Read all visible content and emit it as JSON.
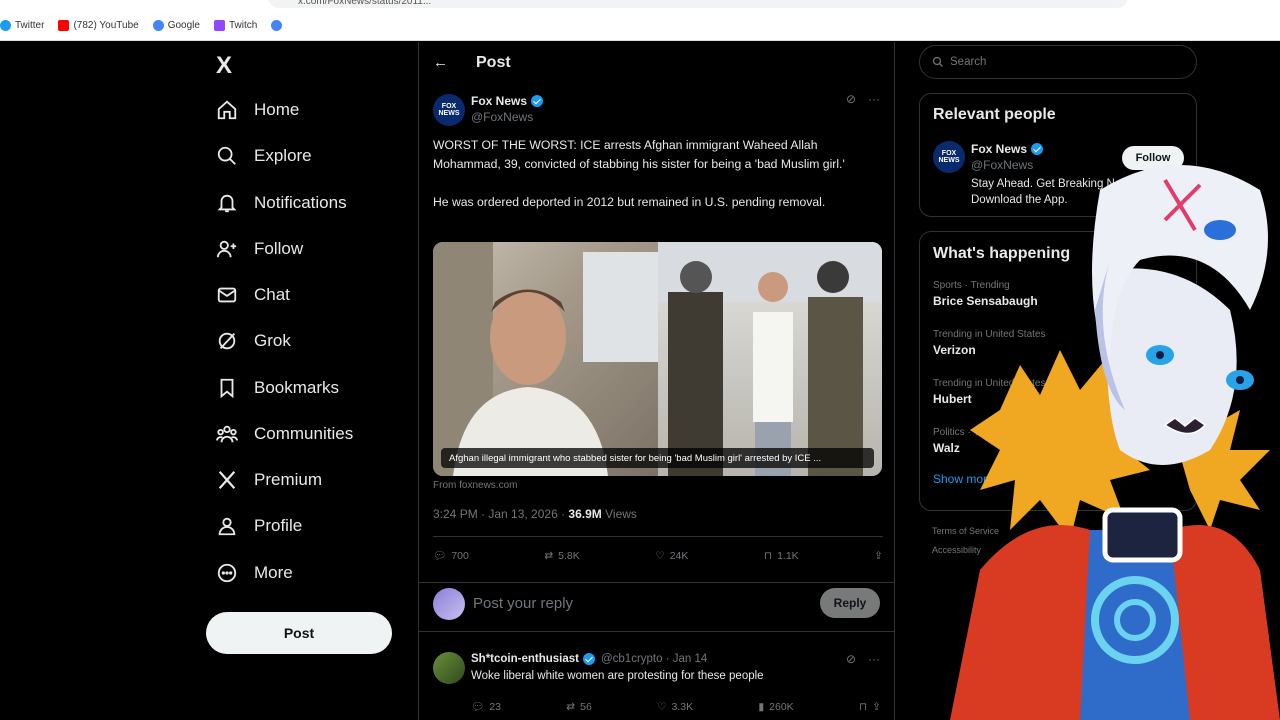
{
  "browser": {
    "url": "x.com/FoxNews/status/2011...",
    "bookmarks": [
      {
        "label": "Twitter",
        "color": "#1d9bf0"
      },
      {
        "label": "(782) YouTube",
        "color": "#ff0000"
      },
      {
        "label": "Google",
        "color": "#4285f4"
      },
      {
        "label": "Twitch",
        "color": "#9146ff"
      },
      {
        "label": "",
        "color": "#4285f4"
      }
    ]
  },
  "nav": {
    "logo": "X",
    "items": [
      {
        "label": "Home",
        "icon": "home-icon"
      },
      {
        "label": "Explore",
        "icon": "search-icon"
      },
      {
        "label": "Notifications",
        "icon": "bell-icon"
      },
      {
        "label": "Follow",
        "icon": "person-add-icon"
      },
      {
        "label": "Chat",
        "icon": "mail-icon"
      },
      {
        "label": "Grok",
        "icon": "grok-icon"
      },
      {
        "label": "Bookmarks",
        "icon": "bookmark-icon"
      },
      {
        "label": "Communities",
        "icon": "people-icon"
      },
      {
        "label": "Premium",
        "icon": "x-icon"
      },
      {
        "label": "Profile",
        "icon": "person-icon"
      },
      {
        "label": "More",
        "icon": "more-circle-icon"
      }
    ],
    "post_label": "Post"
  },
  "header": {
    "back": "←",
    "title": "Post"
  },
  "tweet": {
    "author_name": "Fox News",
    "author_handle": "@FoxNews",
    "avatar_text": "FOX NEWS",
    "text_1": "WORST OF THE WORST: ICE arrests Afghan immigrant Waheed Allah Mohammad, 39, convicted of stabbing his sister for being a 'bad Muslim girl.'",
    "text_2": "He was ordered deported in 2012 but remained in U.S. pending removal.",
    "media_caption": "Afghan illegal immigrant who stabbed sister for being 'bad Muslim girl' arrested by ICE ...",
    "source": "From foxnews.com",
    "time": "3:24 PM · Jan 13, 2026 · ",
    "views_count": "36.9M",
    "views_label": " Views",
    "replies": "700",
    "reposts": "5.8K",
    "likes": "24K",
    "bookmarks": "1.1K"
  },
  "reply_box": {
    "placeholder": "Post your reply",
    "button": "Reply"
  },
  "reply": {
    "name": "Sh*tcoin-enthusiast",
    "handle": "@cb1crypto · Jan 14",
    "text": "Woke liberal white women are protesting for these people",
    "replies": "23",
    "reposts": "56",
    "likes": "3.3K",
    "views": "260K"
  },
  "search": {
    "placeholder": "Search"
  },
  "relevant": {
    "title": "Relevant people",
    "name": "Fox News",
    "handle": "@FoxNews",
    "bio": "Stay Ahead. Get Breaking News First. Download the App.",
    "follow": "Follow"
  },
  "happening": {
    "title": "What's happening",
    "trends": [
      {
        "context": "Sports · Trending",
        "topic": "Brice Sensabaugh"
      },
      {
        "context": "Trending in United States",
        "topic": "Verizon"
      },
      {
        "context": "Trending in United States",
        "topic": "Hubert"
      },
      {
        "context": "Politics · Trending",
        "topic": "Walz"
      }
    ],
    "show_more": "Show more"
  },
  "footer": {
    "line1": "Terms of Service",
    "line2": "Accessibility"
  }
}
